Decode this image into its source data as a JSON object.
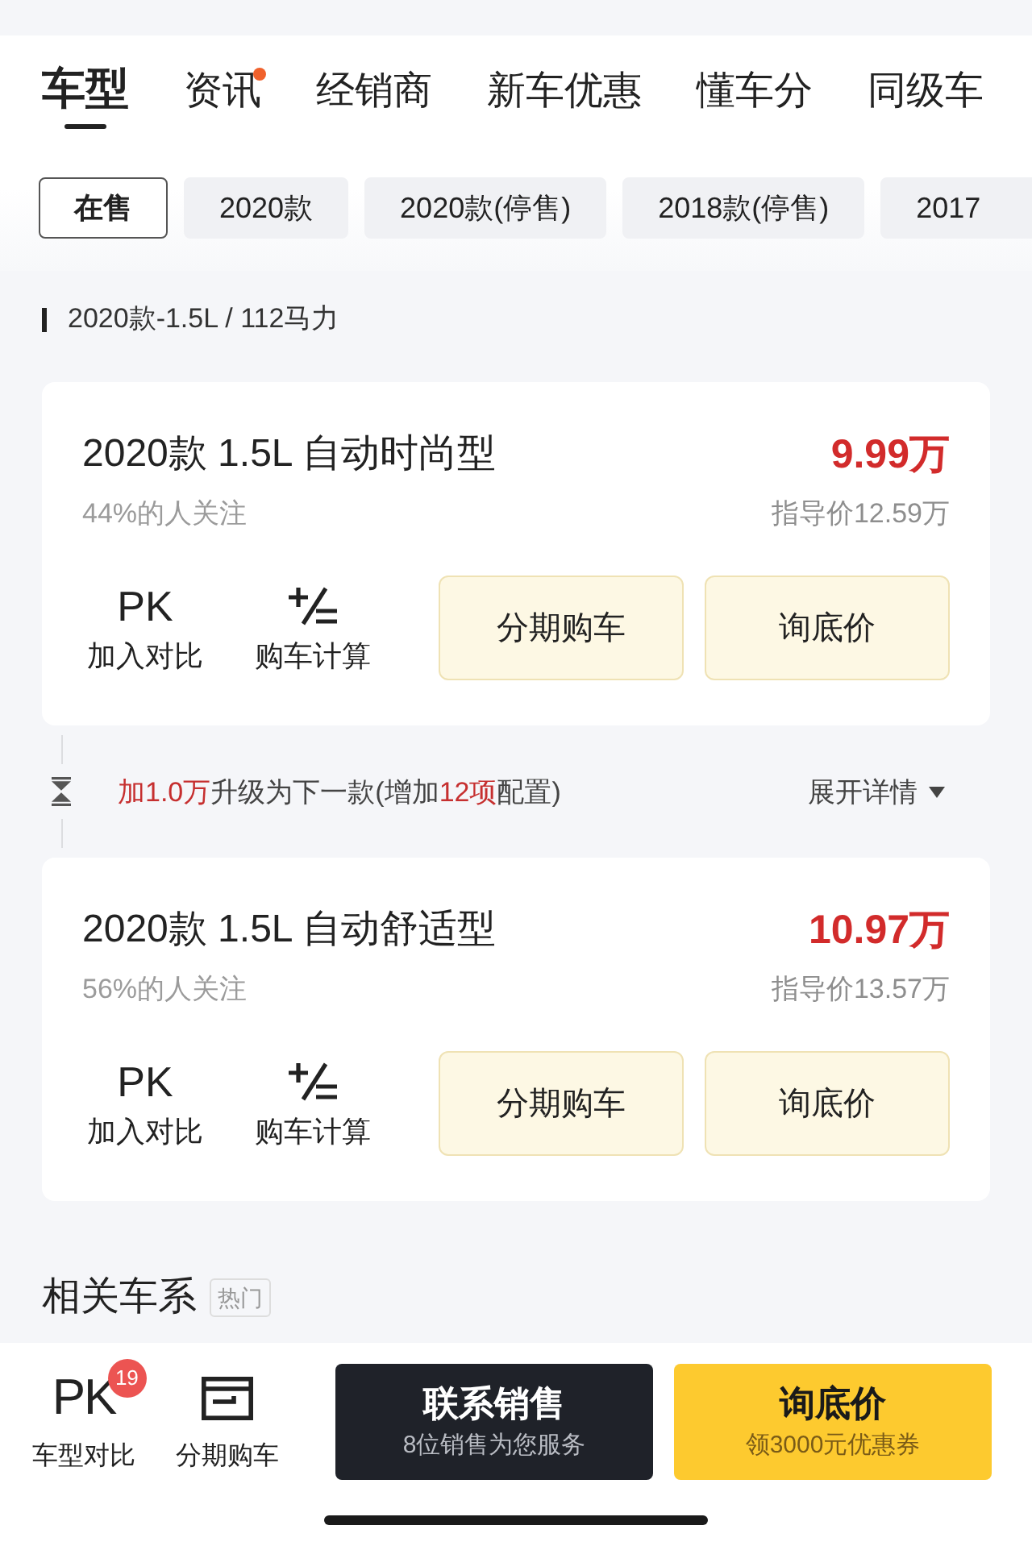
{
  "tabs": [
    {
      "label": "车型",
      "selected": true,
      "dot": false
    },
    {
      "label": "资讯",
      "selected": false,
      "dot": true
    },
    {
      "label": "经销商",
      "selected": false,
      "dot": false
    },
    {
      "label": "新车优惠",
      "selected": false,
      "dot": false
    },
    {
      "label": "懂车分",
      "selected": false,
      "dot": false
    },
    {
      "label": "同级车",
      "selected": false,
      "dot": false
    }
  ],
  "filters": [
    {
      "label": "在售",
      "selected": true
    },
    {
      "label": "2020款",
      "selected": false
    },
    {
      "label": "2020款(停售)",
      "selected": false
    },
    {
      "label": "2018款(停售)",
      "selected": false
    },
    {
      "label": "2017",
      "selected": false
    }
  ],
  "group": {
    "title": "2020款-1.5L / 112马力"
  },
  "trims": [
    {
      "name": "2020款 1.5L 自动时尚型",
      "attention": "44%的人关注",
      "price": "9.99万",
      "guide_price": "指导价12.59万",
      "tools": [
        {
          "kind": "compare",
          "icon_text": "PK",
          "label": "加入对比"
        },
        {
          "kind": "calculator",
          "label": "购车计算"
        }
      ],
      "buttons": [
        "分期购车",
        "询底价"
      ],
      "upgrade": {
        "segments": [
          {
            "text": "加1.0万",
            "highlight": true
          },
          {
            "text": "升级为下一款(增加",
            "highlight": false
          },
          {
            "text": "12项",
            "highlight": true
          },
          {
            "text": "配置)",
            "highlight": false
          }
        ],
        "expand": "展开详情"
      }
    },
    {
      "name": "2020款 1.5L 自动舒适型",
      "attention": "56%的人关注",
      "price": "10.97万",
      "guide_price": "指导价13.57万",
      "tools": [
        {
          "kind": "compare",
          "icon_text": "PK",
          "label": "加入对比"
        },
        {
          "kind": "calculator",
          "label": "购车计算"
        }
      ],
      "buttons": [
        "分期购车",
        "询底价"
      ]
    }
  ],
  "related": {
    "title": "相关车系",
    "tag": "热门"
  },
  "bottom_bar": {
    "tools": [
      {
        "kind": "compare",
        "icon_text": "PK",
        "badge": "19",
        "label": "车型对比"
      },
      {
        "kind": "installment",
        "label": "分期购车"
      }
    ],
    "buttons": [
      {
        "kind": "contact",
        "title": "联系销售",
        "subtitle": "8位销售为您服务"
      },
      {
        "kind": "inquiry",
        "title": "询底价",
        "subtitle": "领3000元优惠券"
      }
    ]
  }
}
